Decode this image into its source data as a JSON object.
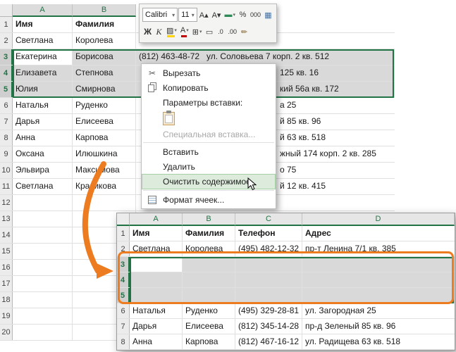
{
  "colors": {
    "selection_green": "#217346",
    "selection_fill": "#d9d9d9",
    "menu_highlight": "#dcebdc",
    "annotation_orange": "#ed7b1f",
    "grid_line": "#e0e0e0"
  },
  "mini_toolbar": {
    "font_name": "Calibri",
    "font_size": "11",
    "row1_icons": [
      {
        "name": "grow-font-icon",
        "glyph": "A▴"
      },
      {
        "name": "shrink-font-icon",
        "glyph": "A▾"
      },
      {
        "name": "accounting-format-icon",
        "glyph": "▬",
        "dropdown": true
      },
      {
        "name": "percent-style-icon",
        "glyph": "%"
      },
      {
        "name": "comma-style-icon",
        "glyph": "000"
      },
      {
        "name": "table-format-icon",
        "glyph": "▦"
      }
    ],
    "row2_icons": [
      {
        "name": "bold-icon",
        "glyph": "Ж"
      },
      {
        "name": "italic-icon",
        "glyph": "К"
      },
      {
        "name": "fill-color-icon",
        "glyph": "▨",
        "dropdown": true
      },
      {
        "name": "font-color-icon",
        "glyph": "А",
        "dropdown": true
      },
      {
        "name": "borders-icon",
        "glyph": "⊞",
        "dropdown": true
      },
      {
        "name": "merge-center-icon",
        "glyph": "▭"
      },
      {
        "name": "increase-decimal-icon",
        "glyph": ".0"
      },
      {
        "name": "decrease-decimal-icon",
        "glyph": ".00"
      },
      {
        "name": "format-painter-icon",
        "glyph": "✏"
      }
    ]
  },
  "context_menu": {
    "items": [
      {
        "label": "Вырезать",
        "icon": "scissors"
      },
      {
        "label": "Копировать",
        "icon": "copy"
      },
      {
        "label": "Параметры вставки:",
        "label_row": true
      },
      {
        "label": "",
        "icon_row": true
      },
      {
        "label": "Специальная вставка...",
        "disabled": true
      },
      {
        "label": "Вставить",
        "separator_before": true
      },
      {
        "label": "Удалить"
      },
      {
        "label": "Очистить содержимое",
        "highlighted": true
      },
      {
        "label": "Формат ячеек...",
        "icon": "format-cells",
        "separator_before": true
      }
    ]
  },
  "main_sheet": {
    "col_headers": [
      "A",
      "B"
    ],
    "rows": [
      {
        "n": "1",
        "a": "Имя",
        "b": "Фамилия",
        "bold": true
      },
      {
        "n": "2",
        "a": "Светлана",
        "b": "Королева"
      },
      {
        "n": "3",
        "a": "Екатерина",
        "b": "Борисова",
        "phone": "(812) 463-48-72",
        "addr": "ул. Соловьева 7 корп. 2 кв. 512",
        "selected": true,
        "active": true
      },
      {
        "n": "4",
        "a": "Елизавета",
        "b": "Степнова",
        "frag": "125 кв. 16",
        "selected": true
      },
      {
        "n": "5",
        "a": "Юлия",
        "b": "Смирнова",
        "frag": "кий 56а кв. 172",
        "selected": true
      },
      {
        "n": "6",
        "a": "Наталья",
        "b": "Руденко",
        "frag": "а 25"
      },
      {
        "n": "7",
        "a": "Дарья",
        "b": "Елисеева",
        "frag": "й 85 кв. 96"
      },
      {
        "n": "8",
        "a": "Анна",
        "b": "Карпова",
        "frag": "й 63 кв. 518"
      },
      {
        "n": "9",
        "a": "Оксана",
        "b": "Илюшкина",
        "frag": "жный 174 корп. 2 кв. 285"
      },
      {
        "n": "10",
        "a": "Эльвира",
        "b": "Максимова",
        "frag": "о 75"
      },
      {
        "n": "11",
        "a": "Светлана",
        "b": "Красикова",
        "frag": "й 12 кв. 415"
      },
      {
        "n": "12"
      },
      {
        "n": "13"
      },
      {
        "n": "14"
      },
      {
        "n": "15"
      },
      {
        "n": "16"
      },
      {
        "n": "17"
      },
      {
        "n": "18"
      },
      {
        "n": "19"
      },
      {
        "n": "20"
      }
    ]
  },
  "result_sheet": {
    "col_headers": [
      "A",
      "B",
      "C",
      "D"
    ],
    "rows": [
      {
        "n": "1",
        "a": "Имя",
        "b": "Фамилия",
        "c": "Телефон",
        "d": "Адрес",
        "bold": true
      },
      {
        "n": "2",
        "a": "Светлана",
        "b": "Королева",
        "c": "(495) 482-12-32",
        "d": "пр-т Ленина 7/1 кв. 385"
      },
      {
        "n": "3",
        "selected": true,
        "active": true
      },
      {
        "n": "4",
        "selected": true
      },
      {
        "n": "5",
        "selected": true
      },
      {
        "n": "6",
        "a": "Наталья",
        "b": "Руденко",
        "c": "(495) 329-28-81",
        "d": "ул. Загородная 25"
      },
      {
        "n": "7",
        "a": "Дарья",
        "b": "Елисеева",
        "c": "(812) 345-14-28",
        "d": "пр-д Зеленый 85 кв. 96"
      },
      {
        "n": "8",
        "a": "Анна",
        "b": "Карпова",
        "c": "(812) 467-16-12",
        "d": "ул. Радищева 63 кв. 518"
      }
    ]
  }
}
